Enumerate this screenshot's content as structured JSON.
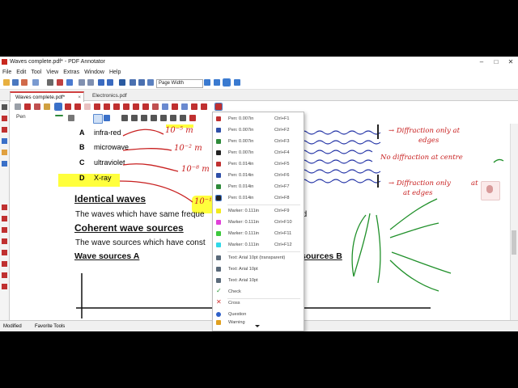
{
  "window": {
    "title": "Waves complete.pdf* - PDF Annotator"
  },
  "menu": [
    "File",
    "Edit",
    "Tool",
    "View",
    "Extras",
    "Window",
    "Help"
  ],
  "toolbar": {
    "zoom_value": "Page Width"
  },
  "tabs": [
    {
      "label": "Waves complete.pdf*",
      "active": true
    },
    {
      "label": "Electronics.pdf",
      "active": false
    }
  ],
  "toolbar3": {
    "pen_label": "Pen"
  },
  "document": {
    "options": [
      {
        "letter": "A",
        "text": "infra-red"
      },
      {
        "letter": "B",
        "text": "microwave"
      },
      {
        "letter": "C",
        "text": "ultraviolet"
      },
      {
        "letter": "D",
        "text": "X-ray"
      }
    ],
    "heading_identical": "Identical waves",
    "text_identical_a": "The waves which have same freque",
    "text_identical_b": "peed",
    "heading_coherent": "Coherent wave sources",
    "text_coherent": "The wave sources which have const",
    "heading_sources_a": "Wave sources A",
    "heading_sources_b": "sources B"
  },
  "handwriting": {
    "diffraction_edges_top_1": "→ Diffraction only at",
    "diffraction_edges_top_2": "edges",
    "no_diffraction": "No diffraction at centre",
    "diffraction_edges_mid_1": "→ Diffraction only",
    "diffraction_edges_mid_2": "at",
    "diffraction_edges_mid_3": "at edges",
    "exp_a": "10⁻⁵ m",
    "exp_b": "10⁻² m",
    "exp_c": "10⁻⁸ m",
    "exp_d": "10⁻¹⁰ m"
  },
  "favorites_menu": [
    {
      "icon": "pen-icon",
      "color": "#c03030",
      "label": "Pen: 0.007in",
      "shortcut": "Ctrl+F1"
    },
    {
      "icon": "pen-icon",
      "color": "#2e4fa8",
      "label": "Pen: 0.007in",
      "shortcut": "Ctrl+F2"
    },
    {
      "icon": "pen-icon",
      "color": "#2e8a3a",
      "label": "Pen: 0.007in",
      "shortcut": "Ctrl+F3"
    },
    {
      "icon": "pen-icon",
      "color": "#222222",
      "label": "Pen: 0.007in",
      "shortcut": "Ctrl+F4"
    },
    {
      "icon": "pen-icon",
      "color": "#c03030",
      "label": "Pen: 0.014in",
      "shortcut": "Ctrl+F5"
    },
    {
      "icon": "pen-icon",
      "color": "#2e4fa8",
      "label": "Pen: 0.014in",
      "shortcut": "Ctrl+F6"
    },
    {
      "icon": "pen-icon",
      "color": "#2e8a3a",
      "label": "Pen: 0.014in",
      "shortcut": "Ctrl+F7"
    },
    {
      "icon": "pen-icon",
      "color": "#222222",
      "label": "Pen: 0.014in",
      "shortcut": "Ctrl+F8"
    },
    {
      "icon": "marker-icon",
      "color": "#f2ea1c",
      "label": "Marker: 0.111in",
      "shortcut": "Ctrl+F9"
    },
    {
      "icon": "marker-icon",
      "color": "#e040d8",
      "label": "Marker: 0.111in",
      "shortcut": "Ctrl+F10"
    },
    {
      "icon": "marker-icon",
      "color": "#3cc83c",
      "label": "Marker: 0.111in",
      "shortcut": "Ctrl+F11"
    },
    {
      "icon": "marker-icon",
      "color": "#30d8e8",
      "label": "Marker: 0.111in",
      "shortcut": "Ctrl+F12"
    },
    {
      "icon": "text-icon",
      "color": "#5a6a7a",
      "label": "Text: Arial 10pt (transparent)",
      "shortcut": ""
    },
    {
      "icon": "text-icon",
      "color": "#5a6a7a",
      "label": "Text: Arial 10pt",
      "shortcut": ""
    },
    {
      "icon": "text-icon",
      "color": "#5a6a7a",
      "label": "Text: Arial 10pt",
      "shortcut": ""
    },
    {
      "icon": "check-icon",
      "color": "#2e9a3a",
      "label": "Check",
      "shortcut": ""
    },
    {
      "icon": "cross-icon",
      "color": "#d03030",
      "label": "Cross",
      "shortcut": ""
    },
    {
      "icon": "question-icon",
      "color": "#2e5fc8",
      "label": "Question",
      "shortcut": ""
    },
    {
      "icon": "warning-icon",
      "color": "#e0a020",
      "label": "Warning",
      "shortcut": ""
    }
  ],
  "status": {
    "mode": "Modified",
    "favorites": "Favorite Tools"
  }
}
